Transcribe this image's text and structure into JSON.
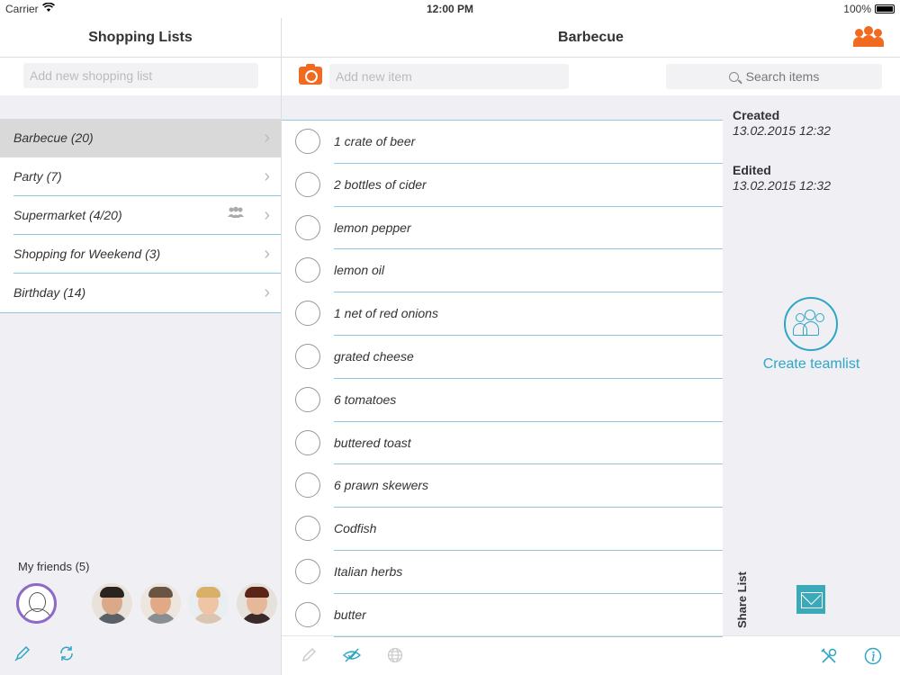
{
  "status_bar": {
    "carrier": "Carrier",
    "time": "12:00 PM",
    "battery": "100%"
  },
  "sidebar": {
    "title": "Shopping Lists",
    "add_placeholder": "Add new shopping list",
    "lists": [
      {
        "label": "Barbecue (20)",
        "selected": true,
        "shared": false
      },
      {
        "label": "Party (7)",
        "selected": false,
        "shared": false
      },
      {
        "label": "Supermarket (4/20)",
        "selected": false,
        "shared": true
      },
      {
        "label": "Shopping for Weekend (3)",
        "selected": false,
        "shared": false
      },
      {
        "label": "Birthday (14)",
        "selected": false,
        "shared": false
      }
    ],
    "friends_title": "My friends (5)"
  },
  "main": {
    "title": "Barbecue",
    "add_item_placeholder": "Add new item",
    "search_placeholder": "Search items",
    "items": [
      "1 crate of beer",
      "2 bottles of cider",
      "lemon pepper",
      "lemon oil",
      "1 net of red onions",
      "grated cheese",
      "6 tomatoes",
      "buttered toast",
      "6 prawn skewers",
      "Codfish",
      "Italian herbs",
      "butter"
    ]
  },
  "details": {
    "created_label": "Created",
    "created_value": "13.02.2015 12:32",
    "edited_label": "Edited",
    "edited_value": "13.02.2015 12:32",
    "create_teamlist": "Create teamlist",
    "share_list": "Share List"
  },
  "colors": {
    "accent": "#2fa6c6",
    "orange": "#f06b1f",
    "divider": "#8ccbe0"
  }
}
